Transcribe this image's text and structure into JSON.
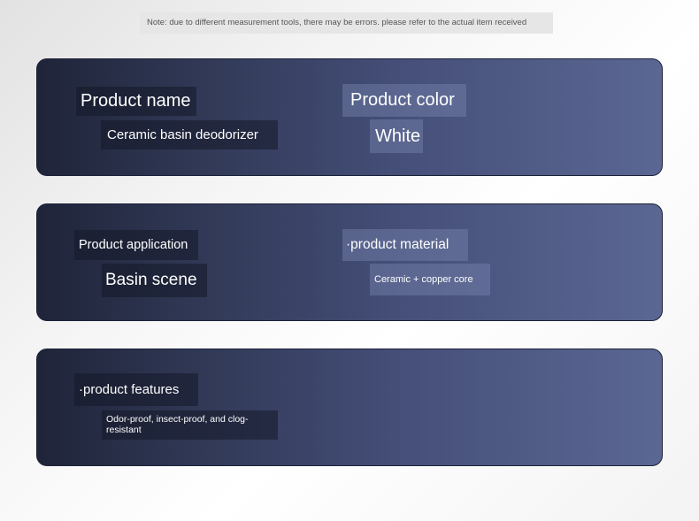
{
  "note": "Note: due to different measurement tools, there may be errors. please refer to the actual item received",
  "cards": [
    {
      "left_label": "Product name",
      "left_value": "Ceramic basin deodorizer",
      "right_label": "Product color",
      "right_value": "White"
    },
    {
      "left_label": "Product application",
      "left_value": "Basin scene",
      "right_label": "·product material",
      "right_value": "Ceramic + copper core"
    },
    {
      "left_label": "·product features",
      "left_value": "Odor-proof, insect-proof, and clog-resistant"
    }
  ],
  "colors": {
    "card_start": "#1f2439",
    "card_end": "#5b6793",
    "text": "#ffffff"
  }
}
